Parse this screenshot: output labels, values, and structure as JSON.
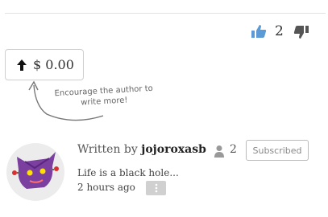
{
  "votes": {
    "like_count": "2"
  },
  "tip": {
    "amount": "$ 0.00",
    "hint": "Encourage the author to write more!"
  },
  "author": {
    "written_by_prefix": "Written by",
    "name": "jojoroxasb",
    "follower_count": "2",
    "subscribe_label": "Subscribed",
    "bio": "Life is a black hole...",
    "posted_time": "2 hours ago"
  },
  "icons": {
    "like": "thumbs-up-icon",
    "dislike": "thumbs-down-icon",
    "tip": "arrow-up-icon",
    "follower": "person-icon",
    "more": "vertical-ellipsis-icon"
  },
  "colors": {
    "like_blue": "#5b9bd5",
    "dislike_gray": "#555555",
    "avatar_purple": "#7b3fa0"
  }
}
